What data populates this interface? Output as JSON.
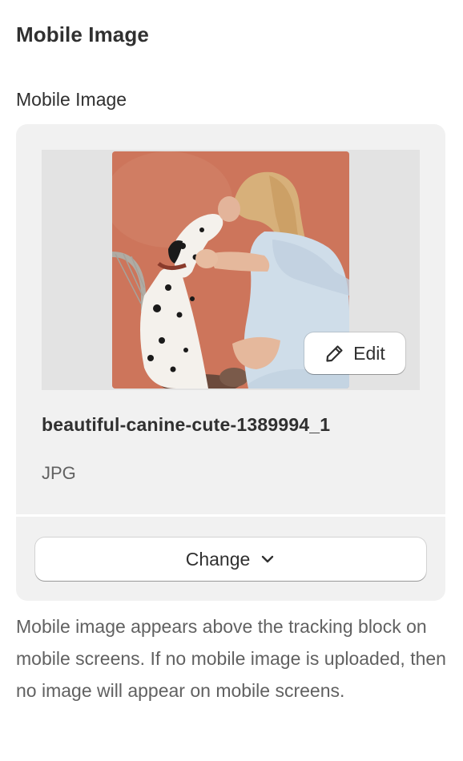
{
  "section": {
    "title": "Mobile Image"
  },
  "field": {
    "label": "Mobile Image"
  },
  "file": {
    "name": "beautiful-canine-cute-1389994_1",
    "type": "JPG"
  },
  "buttons": {
    "edit_label": "Edit",
    "change_label": "Change"
  },
  "help": {
    "text": "Mobile image appears above the tracking block on mobile screens. If no mobile image is uploaded, then no image will appear on mobile screens."
  },
  "icons": {
    "edit": "pencil-icon",
    "change": "chevron-down-icon"
  },
  "colors": {
    "card_background": "#f1f1f1",
    "preview_background": "#e3e3e3",
    "text_primary": "#303030",
    "text_secondary": "#616161"
  }
}
